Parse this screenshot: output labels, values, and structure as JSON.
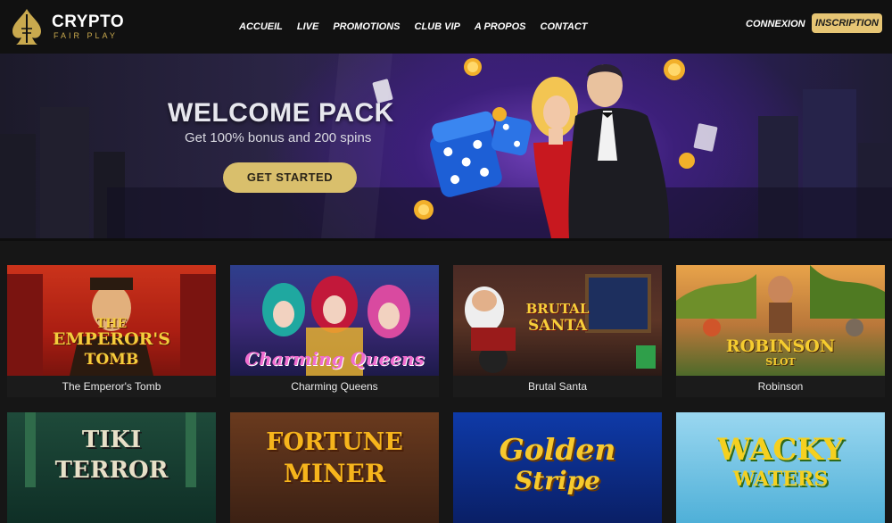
{
  "brand": {
    "title": "CRYPTO",
    "subtitle": "FAIR PLAY",
    "accent": "#e6c574"
  },
  "nav": [
    "ACCUEIL",
    "LIVE",
    "PROMOTIONS",
    "CLUB VIP",
    "A PROPOS",
    "CONTACT"
  ],
  "auth": {
    "login": "CONNEXION",
    "signup": "INSCRIPTION"
  },
  "hero": {
    "title": "WELCOME PACK",
    "subtitle": "Get 100% bonus and 200 spins",
    "cta": "GET STARTED"
  },
  "games": [
    {
      "name": "The Emperor's Tomb",
      "art_text": [
        "THE",
        "EMPEROR'S",
        "TOMB"
      ]
    },
    {
      "name": "Charming Queens",
      "art_text": [
        "Charming Queens"
      ]
    },
    {
      "name": "Brutal Santa",
      "art_text": [
        "BRUTAL",
        "SANTA"
      ]
    },
    {
      "name": "Robinson",
      "art_text": [
        "ROBINSON",
        "SLOT"
      ]
    },
    {
      "name": "Tiki Terror",
      "art_text": [
        "TIKI",
        "TERROR"
      ]
    },
    {
      "name": "Fortune Miner",
      "art_text": [
        "FORTUNE",
        "MINER"
      ]
    },
    {
      "name": "Golden Stripe",
      "art_text": [
        "Golden",
        "Stripe"
      ]
    },
    {
      "name": "Wacky Waters",
      "art_text": [
        "WACKY",
        "WATERS"
      ]
    }
  ]
}
